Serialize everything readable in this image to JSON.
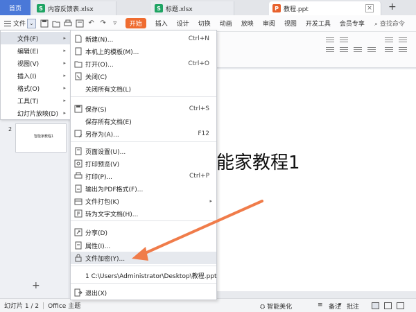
{
  "tabs": {
    "home": "首页",
    "doc1": "内容反馈表.xlsx",
    "doc2": "标题.xlsx",
    "doc3": "教程.ppt",
    "xls_letter": "S",
    "ppt_letter": "P",
    "close": "×",
    "add": "+"
  },
  "ribbon": {
    "file_label": "文件",
    "start_button": "开始",
    "tabs": [
      "插入",
      "设计",
      "切换",
      "动画",
      "放映",
      "审阅",
      "视图",
      "开发工具",
      "会员专享"
    ],
    "search": "查找命令"
  },
  "main_menu": {
    "items": [
      {
        "label": "文件(F)",
        "arrow": "▸"
      },
      {
        "label": "编辑(E)",
        "arrow": "▸"
      },
      {
        "label": "视图(V)",
        "arrow": "▸"
      },
      {
        "label": "插入(I)",
        "arrow": "▸"
      },
      {
        "label": "格式(O)",
        "arrow": "▸"
      },
      {
        "label": "工具(T)",
        "arrow": "▸"
      },
      {
        "label": "幻灯片放映(D)",
        "arrow": "▸"
      }
    ]
  },
  "submenu": {
    "new": {
      "label": "新建(N)...",
      "shortcut": "Ctrl+N"
    },
    "template": {
      "label": "本机上的模板(M)..."
    },
    "open": {
      "label": "打开(O)...",
      "shortcut": "Ctrl+O"
    },
    "close": {
      "label": "关闭(C)"
    },
    "close_all": {
      "label": "关闭所有文档(L)"
    },
    "save": {
      "label": "保存(S)",
      "shortcut": "Ctrl+S"
    },
    "save_all": {
      "label": "保存所有文档(E)"
    },
    "save_as": {
      "label": "另存为(A)...",
      "shortcut": "F12"
    },
    "page_setup": {
      "label": "页面设置(U)..."
    },
    "print_preview": {
      "label": "打印预览(V)"
    },
    "print": {
      "label": "打印(P)...",
      "shortcut": "Ctrl+P"
    },
    "export_pdf": {
      "label": "输出为PDF格式(F)..."
    },
    "package": {
      "label": "文件打包(K)",
      "arrow": "▸"
    },
    "to_text": {
      "label": "转为文字文档(H)..."
    },
    "share": {
      "label": "分享(D)"
    },
    "properties": {
      "label": "属性(I)..."
    },
    "encrypt": {
      "label": "文件加密(Y)..."
    },
    "recent": {
      "label": "1 C:\\Users\\Administrator\\Desktop\\教程.ppt"
    },
    "exit": {
      "label": "退出(X)"
    }
  },
  "slides_panel": {
    "number": "2",
    "thumb_text": "智能家教程1",
    "add": "+"
  },
  "slide": {
    "title": "能家教程1"
  },
  "status": {
    "slide_info": "幻灯片 1 / 2",
    "theme": "Office 主题",
    "beautify": "智能美化",
    "align": "≡",
    "notes": "备注",
    "comments": "批注"
  },
  "colors": {
    "accent": "#ef6c30",
    "home_tab": "#4a78d8",
    "arrow": "#f07c4a"
  }
}
